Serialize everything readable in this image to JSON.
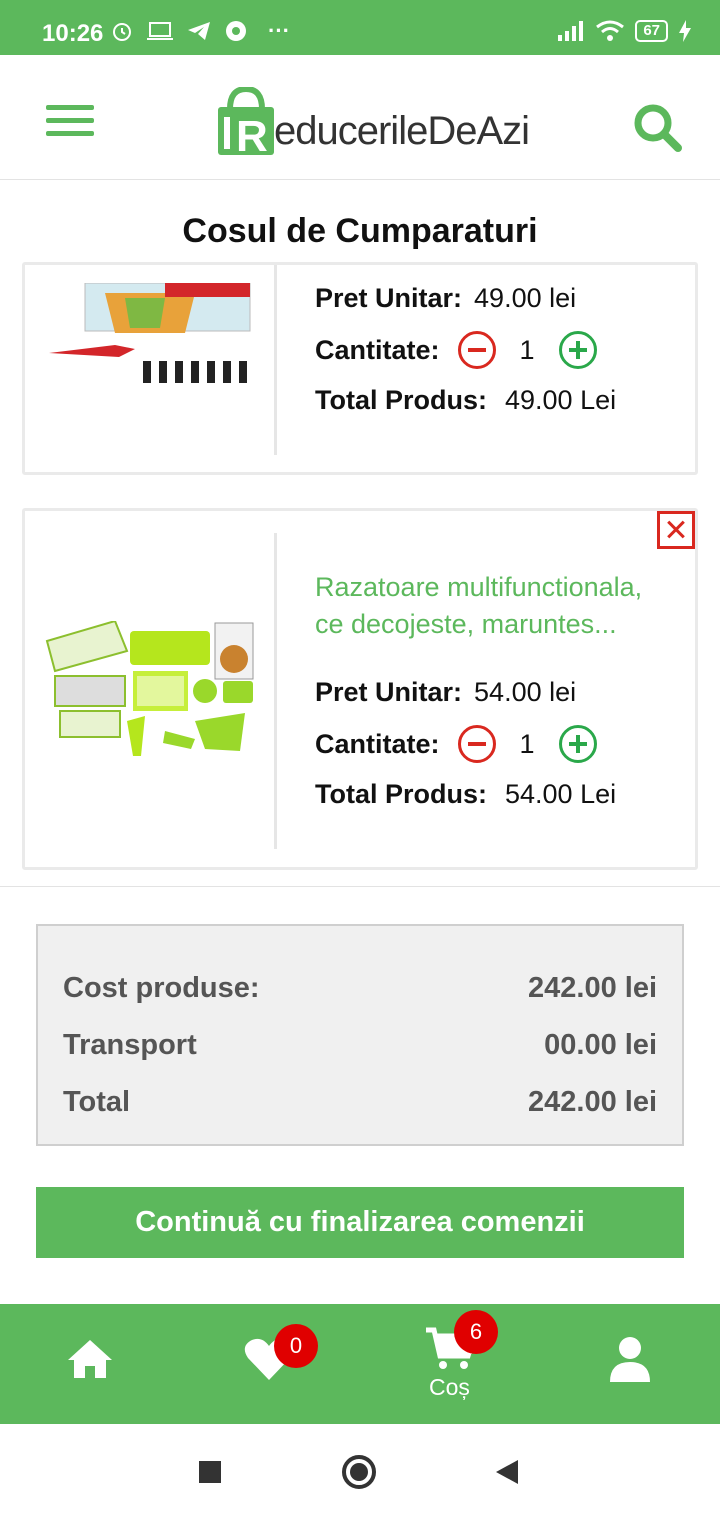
{
  "status_bar": {
    "time": "10:26",
    "battery": "67",
    "icons": [
      "alarm-icon",
      "laptop-icon",
      "telegram-icon",
      "chrome-icon",
      "more-icon",
      "signal-icon",
      "wifi-icon",
      "battery-icon",
      "charging-icon"
    ]
  },
  "header": {
    "logo_text": "educerileDeAzi",
    "logo_letter": "R"
  },
  "page_title": "Cosul de Cumparaturi",
  "cart_items": [
    {
      "title": "",
      "unit_price_label": "Pret Unitar:",
      "unit_price": "49.00 lei",
      "quantity_label": "Cantitate:",
      "quantity": "1",
      "total_label": "Total Produs:",
      "total": "49.00 Lei"
    },
    {
      "title_line1": "Razatoare multifunctionala,",
      "title_line2": "ce decojeste, maruntes...",
      "unit_price_label": "Pret Unitar:",
      "unit_price": "54.00 lei",
      "quantity_label": "Cantitate:",
      "quantity": "1",
      "total_label": "Total Produs:",
      "total": "54.00 Lei"
    }
  ],
  "summary": {
    "products_label": "Cost produse:",
    "products_value": "242.00 lei",
    "transport_label": "Transport",
    "transport_value": "00.00 lei",
    "total_label": "Total",
    "total_value": "242.00 lei"
  },
  "checkout_button": "Continuă cu finalizarea comenzii",
  "bottom_nav": {
    "wishlist_badge": "0",
    "cart_badge": "6",
    "cart_label": "Coș"
  },
  "colors": {
    "brand_green": "#5cb85c",
    "remove_red": "#d9281f",
    "plus_green": "#2aa84a",
    "badge_red": "#e00000"
  }
}
